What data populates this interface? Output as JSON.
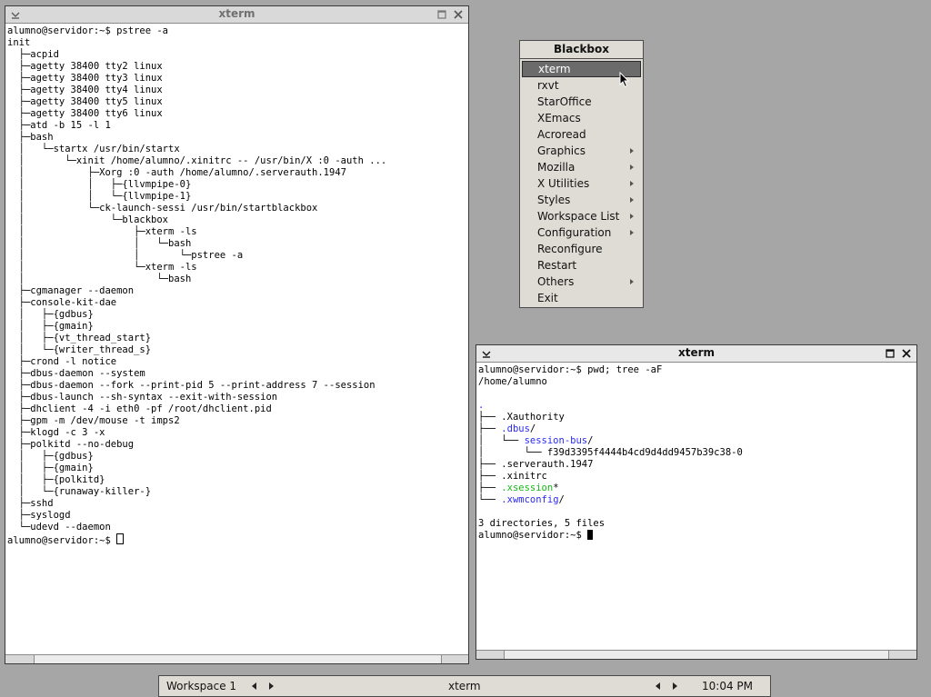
{
  "left_xterm": {
    "title": "xterm",
    "lines": [
      "alumno@servidor:~$ pstree -a",
      "init",
      "  ├─acpid",
      "  ├─agetty 38400 tty2 linux",
      "  ├─agetty 38400 tty3 linux",
      "  ├─agetty 38400 tty4 linux",
      "  ├─agetty 38400 tty5 linux",
      "  ├─agetty 38400 tty6 linux",
      "  ├─atd -b 15 -l 1",
      "  ├─bash",
      "  │   └─startx /usr/bin/startx",
      "  │       └─xinit /home/alumno/.xinitrc -- /usr/bin/X :0 -auth ...",
      "  │           ├─Xorg :0 -auth /home/alumno/.serverauth.1947",
      "  │           │   ├─{llvmpipe-0}",
      "  │           │   └─{llvmpipe-1}",
      "  │           └─ck-launch-sessi /usr/bin/startblackbox",
      "  │               └─blackbox",
      "  │                   ├─xterm -ls",
      "  │                   │   └─bash",
      "  │                   │       └─pstree -a",
      "  │                   └─xterm -ls",
      "  │                       └─bash",
      "  ├─cgmanager --daemon",
      "  ├─console-kit-dae",
      "  │   ├─{gdbus}",
      "  │   ├─{gmain}",
      "  │   ├─{vt_thread_start}",
      "  │   └─{writer_thread_s}",
      "  ├─crond -l notice",
      "  ├─dbus-daemon --system",
      "  ├─dbus-daemon --fork --print-pid 5 --print-address 7 --session",
      "  ├─dbus-launch --sh-syntax --exit-with-session",
      "  ├─dhclient -4 -i eth0 -pf /root/dhclient.pid",
      "  ├─gpm -m /dev/mouse -t imps2",
      "  ├─klogd -c 3 -x",
      "  ├─polkitd --no-debug",
      "  │   ├─{gdbus}",
      "  │   ├─{gmain}",
      "  │   ├─{polkitd}",
      "  │   └─{runaway-killer-}",
      "  ├─sshd",
      "  ├─syslogd",
      "  └─udevd --daemon"
    ],
    "prompt": "alumno@servidor:~$ "
  },
  "right_xterm": {
    "title": "xterm",
    "cmd_line": "alumno@servidor:~$ pwd; tree -aF",
    "pwd": "/home/alumno",
    "root": ".",
    "branch_xauth": "├── ",
    "xauth": ".Xauthority",
    "branch_dbus": "├── ",
    "dbus": ".dbus",
    "slash": "/",
    "sub_branch_session": "│   └── ",
    "session_bus": "session-bus",
    "sub_branch_file": "│       └── ",
    "session_file": "f39d3395f4444b4cd9d4dd9457b39c38-0",
    "branch_serverauth": "├── ",
    "serverauth": ".serverauth.1947",
    "branch_xinitrc": "├── ",
    "xinitrc": ".xinitrc",
    "branch_xsession": "├── ",
    "xsession": ".xsession",
    "star": "*",
    "branch_xwmconfig": "└── ",
    "xwmconfig": ".xwmconfig",
    "summary": "3 directories, 5 files",
    "prompt": "alumno@servidor:~$ "
  },
  "menu": {
    "title": "Blackbox",
    "items": [
      {
        "label": "xterm"
      },
      {
        "label": "rxvt"
      },
      {
        "label": "StarOffice"
      },
      {
        "label": "XEmacs"
      },
      {
        "label": "Acroread"
      },
      {
        "label": "Graphics"
      },
      {
        "label": "Mozilla"
      },
      {
        "label": "X Utilities"
      },
      {
        "label": "Styles"
      },
      {
        "label": "Workspace List"
      },
      {
        "label": "Configuration"
      },
      {
        "label": "Reconfigure"
      },
      {
        "label": "Restart"
      },
      {
        "label": "Others"
      },
      {
        "label": "Exit"
      }
    ]
  },
  "toolbar": {
    "workspace": "Workspace 1",
    "window": "xterm",
    "clock": "10:04 PM"
  },
  "colors": {
    "desktop": "#a6a6a6",
    "directory": "#2a2af0",
    "executable": "#18b818",
    "menu_highlight": "#6b6b6b"
  },
  "icons": [
    "minimize-icon",
    "maximize-icon",
    "close-icon",
    "mouse-pointer-icon",
    "submenu-arrow-icon"
  ]
}
